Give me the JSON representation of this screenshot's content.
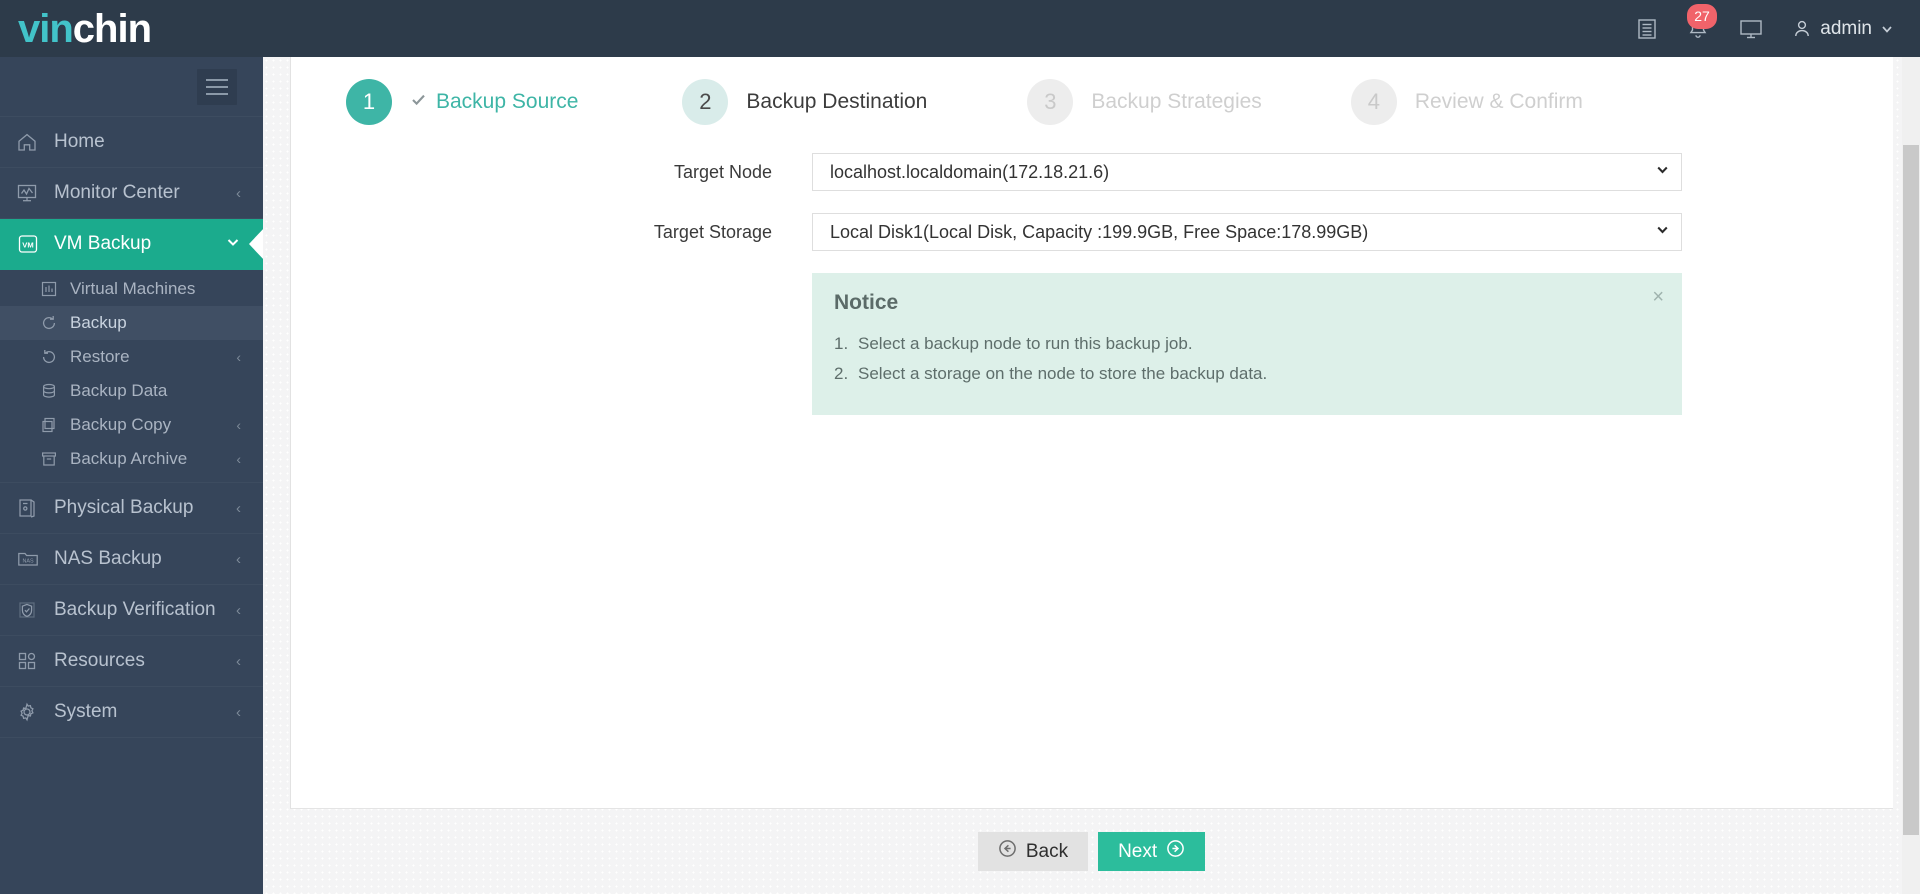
{
  "header": {
    "logo_primary": "vin",
    "logo_secondary": "chin",
    "icons": [
      {
        "name": "log-list-icon",
        "label": "log-list-icon"
      },
      {
        "name": "bell-icon",
        "label": "bell-icon",
        "badge": "27"
      },
      {
        "name": "monitor-icon",
        "label": "monitor-icon"
      }
    ],
    "user": {
      "name": "admin",
      "avatar_icon": "user-icon",
      "chevron_icon": "chevron-down-icon"
    }
  },
  "sidebar": {
    "toggle_icon": "hamburger-icon",
    "items": [
      {
        "label": "Home",
        "icon": "home-icon",
        "expandable": false,
        "active": false
      },
      {
        "label": "Monitor Center",
        "icon": "monitor-chart-icon",
        "expandable": true,
        "active": false
      },
      {
        "label": "VM Backup",
        "icon": "vm-icon",
        "expandable": true,
        "active": true,
        "chevron": "chevron-down-icon"
      },
      {
        "label": "Physical Backup",
        "icon": "server-icon",
        "expandable": true,
        "active": false
      },
      {
        "label": "NAS Backup",
        "icon": "nas-folder-icon",
        "expandable": true,
        "active": false
      },
      {
        "label": "Backup Verification",
        "icon": "shield-check-icon",
        "expandable": true,
        "active": false
      },
      {
        "label": "Resources",
        "icon": "grid-icon",
        "expandable": true,
        "active": false
      },
      {
        "label": "System",
        "icon": "gear-icon",
        "expandable": true,
        "active": false
      }
    ],
    "submenu": [
      {
        "label": "Virtual Machines",
        "icon": "vm-list-icon",
        "expandable": false,
        "active": false
      },
      {
        "label": "Backup",
        "icon": "refresh-icon",
        "expandable": false,
        "active": true
      },
      {
        "label": "Restore",
        "icon": "restore-icon",
        "expandable": true,
        "active": false
      },
      {
        "label": "Backup Data",
        "icon": "database-icon",
        "expandable": true,
        "active": false
      },
      {
        "label": "Backup Copy",
        "icon": "copy-icon",
        "expandable": true,
        "active": false
      },
      {
        "label": "Backup Archive",
        "icon": "archive-icon",
        "expandable": true,
        "active": false
      }
    ],
    "chevron_right": "‹"
  },
  "wizard": {
    "steps": [
      {
        "number": "1",
        "label": "Backup Source",
        "state": "done",
        "check_icon": "check-icon"
      },
      {
        "number": "2",
        "label": "Backup Destination",
        "state": "current"
      },
      {
        "number": "3",
        "label": "Backup Strategies",
        "state": "upcoming"
      },
      {
        "number": "4",
        "label": "Review & Confirm",
        "state": "upcoming"
      }
    ]
  },
  "form": {
    "fields": [
      {
        "label": "Target Node",
        "name": "target-node-select",
        "value": "localhost.localdomain(172.18.21.6)",
        "chevron_icon": "chevron-down-icon"
      },
      {
        "label": "Target Storage",
        "name": "target-storage-select",
        "value": "Local Disk1(Local Disk, Capacity :199.9GB, Free Space:178.99GB)",
        "chevron_icon": "chevron-down-icon"
      }
    ]
  },
  "notice": {
    "title": "Notice",
    "close_icon": "close-icon",
    "close_glyph": "×",
    "items": [
      {
        "num": "1.",
        "text": "Select a backup node to run this backup job."
      },
      {
        "num": "2.",
        "text": "Select a storage on the node to store the backup data."
      }
    ]
  },
  "footer": {
    "back_label": "Back",
    "back_icon": "arrow-left-circle-icon",
    "next_label": "Next",
    "next_icon": "arrow-right-circle-icon"
  },
  "colors": {
    "brand_teal": "#1bab8d",
    "header_dark": "#2d3b4a",
    "sidebar_dark": "#36455a",
    "badge_red": "#f1636a",
    "notice_bg": "#ddf0e9",
    "step_active": "#3eb5a6",
    "next_button": "#2cbd9c"
  }
}
